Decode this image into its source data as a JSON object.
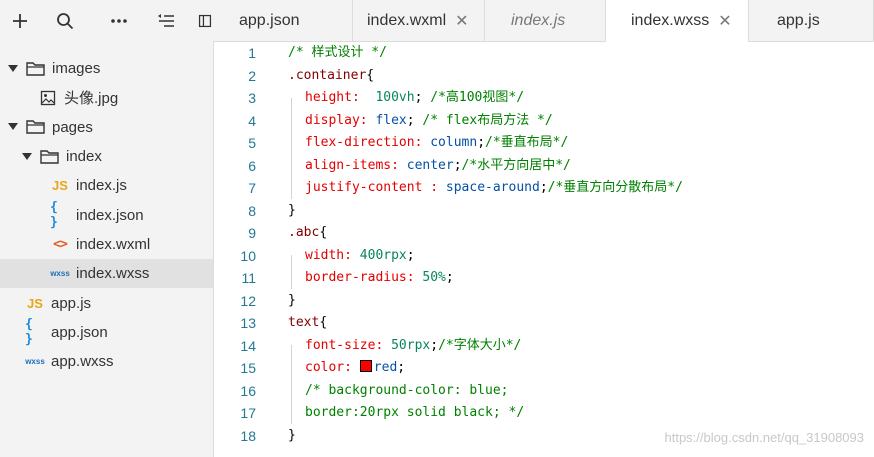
{
  "sidebar": {
    "toolbar": [
      {
        "name": "add-icon"
      },
      {
        "name": "search-icon"
      },
      {
        "name": "more-icon"
      },
      {
        "name": "outline-icon"
      },
      {
        "name": "split-icon"
      }
    ],
    "tree": [
      {
        "label": "images",
        "kind": "folder",
        "depth": 0,
        "expanded": true
      },
      {
        "label": "头像.jpg",
        "kind": "image",
        "depth": 1
      },
      {
        "label": "pages",
        "kind": "folder",
        "depth": 0,
        "expanded": true
      },
      {
        "label": "index",
        "kind": "folder",
        "depth": 1,
        "expanded": true
      },
      {
        "label": "index.js",
        "kind": "js",
        "depth": 2
      },
      {
        "label": "index.json",
        "kind": "json",
        "depth": 2
      },
      {
        "label": "index.wxml",
        "kind": "wxml",
        "depth": 2
      },
      {
        "label": "index.wxss",
        "kind": "wxss",
        "depth": 2,
        "selected": true
      },
      {
        "label": "app.js",
        "kind": "js",
        "depth": 0
      },
      {
        "label": "app.json",
        "kind": "json",
        "depth": 0
      },
      {
        "label": "app.wxss",
        "kind": "wxss",
        "depth": 0
      }
    ],
    "badges": {
      "js": "JS",
      "json": "{ }",
      "wxml": "<>",
      "wxss": "wxss"
    }
  },
  "tabs": [
    {
      "label": "app.json",
      "active": false,
      "closable": false,
      "preview": false
    },
    {
      "label": "index.wxml",
      "active": false,
      "closable": true,
      "preview": false
    },
    {
      "label": "index.js",
      "active": false,
      "closable": false,
      "preview": true
    },
    {
      "label": "index.wxss",
      "active": true,
      "closable": true,
      "preview": false
    },
    {
      "label": "app.js",
      "active": false,
      "closable": false,
      "preview": false
    }
  ],
  "close_glyph": "✕",
  "editor": {
    "lines": [
      {
        "num": "1",
        "indent": false,
        "tokens": [
          [
            "c-com",
            "/* 样式设计 */"
          ]
        ]
      },
      {
        "num": "2",
        "indent": false,
        "tokens": [
          [
            "c-sel",
            ".container"
          ],
          [
            "c-punc",
            "{"
          ]
        ]
      },
      {
        "num": "3",
        "indent": true,
        "tokens": [
          [
            "c-prop",
            "height:  "
          ],
          [
            "c-num",
            "100vh"
          ],
          [
            "c-punc",
            "; "
          ],
          [
            "c-com",
            "/*高100视图*/"
          ]
        ]
      },
      {
        "num": "4",
        "indent": true,
        "tokens": [
          [
            "c-prop",
            "display: "
          ],
          [
            "c-val",
            "flex"
          ],
          [
            "c-punc",
            "; "
          ],
          [
            "c-com",
            "/* flex布局方法 */"
          ]
        ]
      },
      {
        "num": "5",
        "indent": true,
        "tokens": [
          [
            "c-prop",
            "flex-direction: "
          ],
          [
            "c-val",
            "column"
          ],
          [
            "c-punc",
            ";"
          ],
          [
            "c-com",
            "/*垂直布局*/"
          ]
        ]
      },
      {
        "num": "6",
        "indent": true,
        "tokens": [
          [
            "c-prop",
            "align-items: "
          ],
          [
            "c-val",
            "center"
          ],
          [
            "c-punc",
            ";"
          ],
          [
            "c-com",
            "/*水平方向居中*/"
          ]
        ]
      },
      {
        "num": "7",
        "indent": true,
        "tokens": [
          [
            "c-prop",
            "justify-content : "
          ],
          [
            "c-val",
            "space-around"
          ],
          [
            "c-punc",
            ";"
          ],
          [
            "c-com",
            "/*垂直方向分散布局*/"
          ]
        ]
      },
      {
        "num": "8",
        "indent": false,
        "tokens": [
          [
            "c-punc",
            "}"
          ]
        ]
      },
      {
        "num": "9",
        "indent": false,
        "tokens": [
          [
            "c-sel",
            ".abc"
          ],
          [
            "c-punc",
            "{"
          ]
        ]
      },
      {
        "num": "10",
        "indent": true,
        "tokens": [
          [
            "c-prop",
            "width: "
          ],
          [
            "c-num",
            "400rpx"
          ],
          [
            "c-punc",
            ";"
          ]
        ]
      },
      {
        "num": "11",
        "indent": true,
        "tokens": [
          [
            "c-prop",
            "border-radius: "
          ],
          [
            "c-num",
            "50%"
          ],
          [
            "c-punc",
            ";"
          ]
        ]
      },
      {
        "num": "12",
        "indent": false,
        "tokens": [
          [
            "c-punc",
            "}"
          ]
        ]
      },
      {
        "num": "13",
        "indent": false,
        "tokens": [
          [
            "c-sel",
            "text"
          ],
          [
            "c-punc",
            "{"
          ]
        ]
      },
      {
        "num": "14",
        "indent": true,
        "tokens": [
          [
            "c-prop",
            "font-size: "
          ],
          [
            "c-num",
            "50rpx"
          ],
          [
            "c-punc",
            ";"
          ],
          [
            "c-com",
            "/*字体大小*/"
          ]
        ]
      },
      {
        "num": "15",
        "indent": true,
        "tokens": [
          [
            "c-prop",
            "color: "
          ],
          [
            "swatch",
            ""
          ],
          [
            "c-val",
            "red"
          ],
          [
            "c-punc",
            ";"
          ]
        ]
      },
      {
        "num": "16",
        "indent": true,
        "tokens": [
          [
            "c-com",
            "/* background-color: blue;"
          ]
        ]
      },
      {
        "num": "17",
        "indent": true,
        "tokens": [
          [
            "c-com",
            "border:20rpx solid black; */"
          ]
        ]
      },
      {
        "num": "18",
        "indent": false,
        "tokens": [
          [
            "c-punc",
            "}"
          ]
        ]
      }
    ],
    "swatch_color": "#ff0000"
  },
  "watermark": "https://blog.csdn.net/qq_31908093",
  "colors": {
    "comment": "#008000",
    "selector": "#800000",
    "property": "#e50000",
    "value": "#0451a5",
    "number": "#098658",
    "line_number": "#237893",
    "sidebar_bg": "#f3f3f3",
    "selected_row_bg": "#e1e1e1"
  }
}
